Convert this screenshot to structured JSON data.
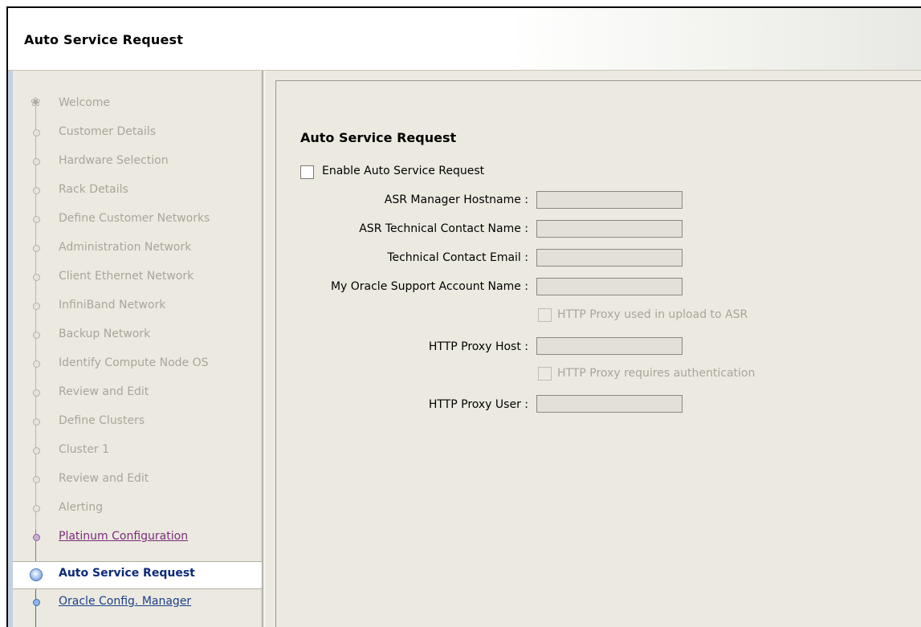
{
  "window": {
    "title": "Auto Service Request"
  },
  "nav": {
    "first_glyph": "❀",
    "items": [
      {
        "label": "Welcome",
        "state": "disabled"
      },
      {
        "label": "Customer Details",
        "state": "disabled"
      },
      {
        "label": "Hardware Selection",
        "state": "disabled"
      },
      {
        "label": "Rack Details",
        "state": "disabled"
      },
      {
        "label": "Define Customer Networks",
        "state": "disabled"
      },
      {
        "label": "Administration Network",
        "state": "disabled"
      },
      {
        "label": "Client Ethernet Network",
        "state": "disabled"
      },
      {
        "label": "InfiniBand Network",
        "state": "disabled"
      },
      {
        "label": "Backup Network",
        "state": "disabled"
      },
      {
        "label": "Identify Compute Node OS",
        "state": "disabled"
      },
      {
        "label": "Review and Edit",
        "state": "disabled"
      },
      {
        "label": "Define Clusters",
        "state": "disabled"
      },
      {
        "label": "Cluster 1",
        "state": "disabled"
      },
      {
        "label": "Review and Edit",
        "state": "disabled"
      },
      {
        "label": "Alerting",
        "state": "disabled"
      },
      {
        "label": "Platinum Configuration",
        "state": "visited"
      },
      {
        "label": "Auto Service Request",
        "state": "current"
      },
      {
        "label": "Oracle Config. Manager",
        "state": "next"
      }
    ]
  },
  "form": {
    "section_title": "Auto Service Request",
    "enable_label": "Enable Auto Service Request",
    "asr_hostname_label": "ASR Manager Hostname :",
    "asr_hostname_value": "",
    "contact_name_label": "ASR Technical Contact Name :",
    "contact_name_value": "",
    "contact_email_label": "Technical Contact Email :",
    "contact_email_value": "",
    "mos_account_label": "My Oracle Support Account Name :",
    "mos_account_value": "",
    "proxy_used_label": "HTTP Proxy used in upload to ASR",
    "proxy_host_label": "HTTP Proxy Host :",
    "proxy_host_value": "",
    "proxy_auth_label": "HTTP Proxy requires authentication",
    "proxy_user_label": "HTTP Proxy User :",
    "proxy_user_value": ""
  }
}
